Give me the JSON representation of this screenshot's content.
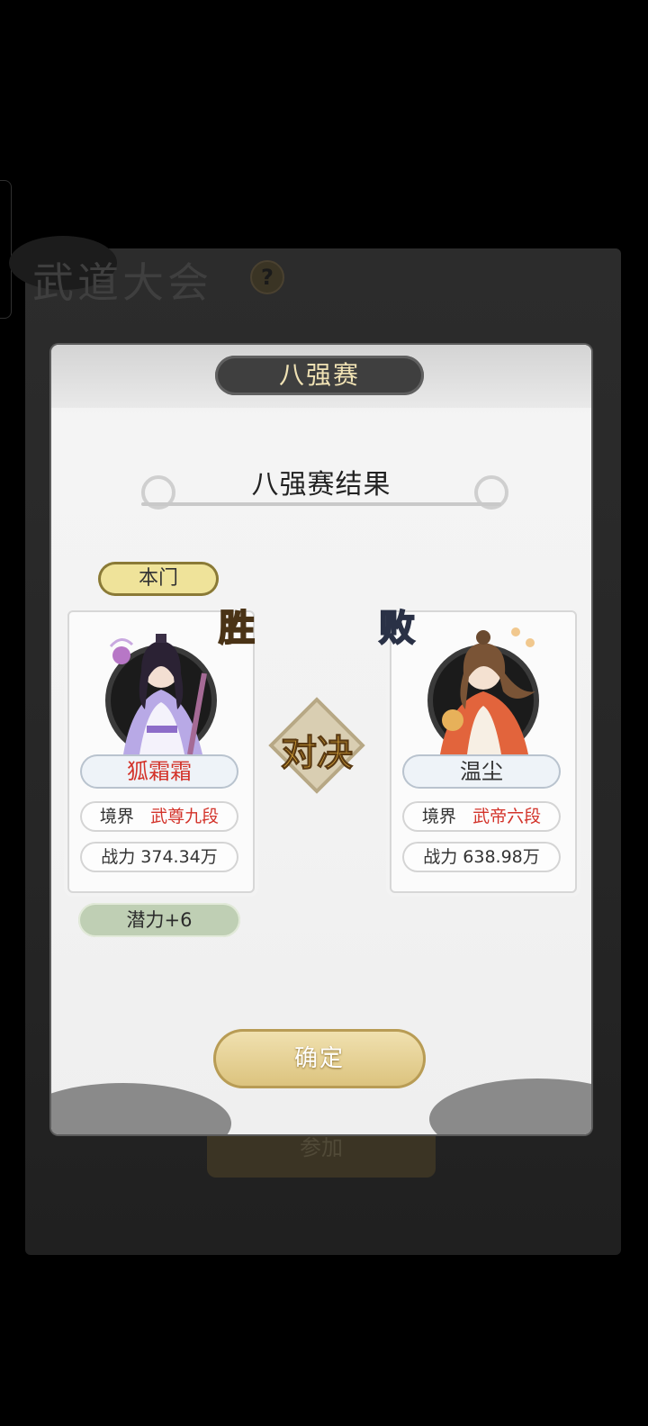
{
  "background": {
    "title": "武道大会",
    "help_icon": "?",
    "join_label": "参加"
  },
  "modal": {
    "title": "八强赛",
    "result_heading": "八强赛结果",
    "vs_text": "对决",
    "confirm_label": "确定"
  },
  "left_player": {
    "tag": "本门",
    "result": "胜",
    "name": "狐霜霜",
    "realm_label": "境界",
    "realm_value": "武尊九段",
    "power_text": "战力 374.34万",
    "reward": "潜力+6"
  },
  "right_player": {
    "result": "败",
    "name": "温尘",
    "realm_label": "境界",
    "realm_value": "武帝六段",
    "power_text": "战力 638.98万"
  },
  "colors": {
    "win_badge": "#f3cc60",
    "lose_badge": "#d4dde8",
    "name_red": "#d3332a",
    "confirm_gold": "#dbc27c"
  }
}
